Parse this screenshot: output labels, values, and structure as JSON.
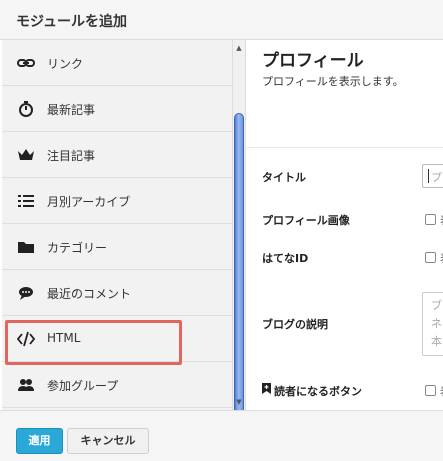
{
  "header": {
    "title": "モジュールを追加"
  },
  "modules": [
    {
      "label": "リンク",
      "icon": "link-icon"
    },
    {
      "label": "最新記事",
      "icon": "stopwatch-icon"
    },
    {
      "label": "注目記事",
      "icon": "crown-icon"
    },
    {
      "label": "月別アーカイブ",
      "icon": "list-icon"
    },
    {
      "label": "カテゴリー",
      "icon": "folder-icon"
    },
    {
      "label": "最近のコメント",
      "icon": "comment-icon"
    },
    {
      "label": "HTML",
      "icon": "code-icon"
    },
    {
      "label": "参加グループ",
      "icon": "group-icon"
    }
  ],
  "settings": {
    "title": "プロフィール",
    "description": "プロフィールを表示します。",
    "fields": {
      "title_label": "タイトル",
      "title_placeholder": "プ",
      "profile_image_label": "プロフィール画像",
      "hatena_id_label": "はてなID",
      "blog_desc_label": "ブログの説明",
      "reader_button_label": "読者になるボタン"
    },
    "checkbox_text": "表",
    "textarea_lines": [
      "ブ",
      "ネ",
      "本"
    ]
  },
  "footer": {
    "apply_label": "適用",
    "cancel_label": "キャンセル"
  },
  "colors": {
    "apply_button": "#2aa9d9",
    "highlight": "#e0675f",
    "scroll_thumb": "#6a95e0"
  }
}
